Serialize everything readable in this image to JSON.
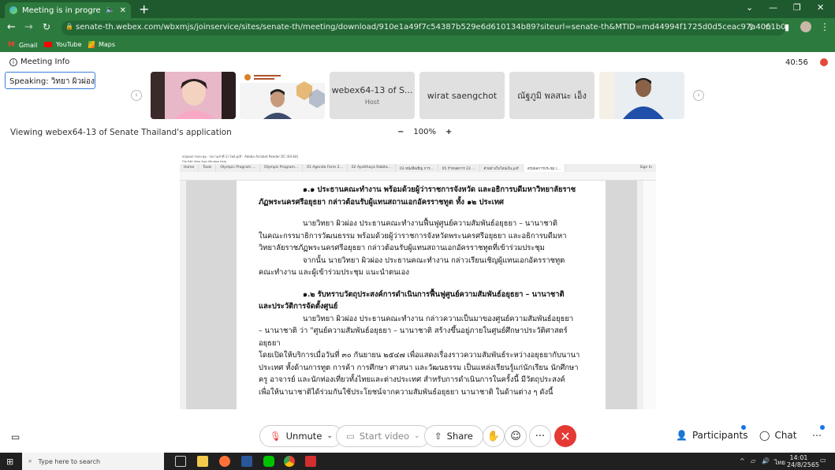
{
  "browser": {
    "tab_title": "Meeting is in progress...",
    "url": "senate-th.webex.com/wbxmjs/joinservice/sites/senate-th/meeting/download/910e1a49f7c54387b529e6d610134b89?siteurl=senate-th&MTID=md44994f1725d0d5ceac97a4061b0d0c6",
    "bookmarks": [
      "Gmail",
      "YouTube",
      "Maps"
    ]
  },
  "meeting": {
    "info_label": "Meeting Info",
    "timer": "40:56",
    "speaking_label": "Speaking: วิทยา ผิวผ่อง",
    "participants": [
      {
        "name": "",
        "sub": "",
        "kind": "video-woman"
      },
      {
        "name": "",
        "sub": "",
        "kind": "video-man-slide"
      },
      {
        "name": "webex64-13 of S...",
        "sub": "Host",
        "kind": "name"
      },
      {
        "name": "wirat saengchot",
        "sub": "",
        "kind": "name"
      },
      {
        "name": "ณัฐภูมิ พลสนะ เอ็ง",
        "sub": "",
        "kind": "name"
      },
      {
        "name": "",
        "sub": "",
        "kind": "video-man"
      }
    ],
    "viewing_text": "Viewing webex64-13 of Senate Thailand's application",
    "zoom_minus": "−",
    "zoom_level": "100%",
    "zoom_plus": "+"
  },
  "shared_doc": {
    "window_title": "สรุปผลการประชุม - (ความจำที่ 1) ไฟล์.pdf - Adobe Acrobat Reader DC (64-bit)",
    "menu": "File  Edit  View  Sign  Window  Help",
    "tabs": [
      "Home",
      "Tools",
      "Olympic Program ...",
      "Olympic Program...",
      "01 Agenda Form 2...",
      "02 Ayutthaya Rabita...",
      "03 หนังสือเชิญ การ...",
      "05 กำหนดการ 23 ...",
      "ตัวอย่างใบโอนเงิน.pdf",
      "สรุปผลการประชุม (..."
    ],
    "signin": "Sign In",
    "lines": [
      {
        "t": "๑.๑ ประธานคณะทำงาน พร้อมด้วยผู้ว่าราชการจังหวัด และอธิการบดีมหาวิทยาลัยราช",
        "c": "h ind"
      },
      {
        "t": "ภัฏพระนครศรีอยุธยา กล่าวต้อนรับผู้แทนสถานเอกอัครราชทูต ทั้ง ๑๒ ประเทศ",
        "c": "h"
      },
      {
        "t": "",
        "c": "gap"
      },
      {
        "t": "นายวิทยา  ผิวผ่อง ประธานคณะทำงานฟื้นฟูศูนย์ความสัมพันธ์อยุธยา – นานาชาติ",
        "c": "ind"
      },
      {
        "t": "ในคณะกรรมาธิการวัฒนธรรม พร้อมด้วยผู้ว่าราชการจังหวัดพระนครศรีอยุธยา และอธิการบดีมหา",
        "c": ""
      },
      {
        "t": "วิทยาลัยราชภัฏพระนครศรีอยุธยา กล่าวต้อนรับผู้แทนสถานเอกอัครราชทูตที่เข้าร่วมประชุม",
        "c": ""
      },
      {
        "t": "จากนั้น นายวิทยา  ผิวผ่อง ประธานคณะทำงาน กล่าวเรียนเชิญผู้แทนเอกอัครราชทูต",
        "c": "ind"
      },
      {
        "t": "คณะทำงาน และผู้เข้าร่วมประชุม แนะนำตนเอง",
        "c": ""
      },
      {
        "t": "",
        "c": "gap"
      },
      {
        "t": "๑.๒ รับทราบวัตถุประสงค์การดำเนินการฟื้นฟูศูนย์ความสัมพันธ์อยุธยา – นานาชาติ",
        "c": "h ind"
      },
      {
        "t": "และประวัติการจัดตั้งศูนย์",
        "c": "h"
      },
      {
        "t": "นายวิทยา  ผิวผ่อง ประธานคณะทำงาน กล่าวความเป็นมาของศูนย์ความสัมพันธ์อยุธยา",
        "c": "ind"
      },
      {
        "t": "– นานาชาติ ว่า \"ศูนย์ความสัมพันธ์อยุธยา – นานาชาติ สร้างขึ้นอยู่ภายในศูนย์ศึกษาประวัติศาสตร์อยุธยา",
        "c": ""
      },
      {
        "t": "โดยเปิดให้บริการเมื่อวันที่ ๓๐ กันยายน ๒๕๔๗ เพื่อแสดงเรื่องราวความสัมพันธ์ระหว่างอยุธยากับนานา",
        "c": ""
      },
      {
        "t": "ประเทศ ทั้งด้านการทูต การค้า การศึกษา ศาสนา และวัฒนธรรม เป็นแหล่งเรียนรู้แก่นักเรียน นักศึกษา",
        "c": ""
      },
      {
        "t": "ครู อาจารย์ และนักท่องเที่ยวทั้งไทยและต่างประเทศ สำหรับการดำเนินการในครั้งนี้ มีวัตถุประสงค์",
        "c": ""
      },
      {
        "t": "เพื่อให้นานาชาติได้ร่วมกันใช้ประโยชน์จากความสัมพันธ์อยุธยา นานาชาติ ในด้านต่าง ๆ ดังนี้",
        "c": ""
      }
    ]
  },
  "controls": {
    "unmute": "Unmute",
    "start_video": "Start video",
    "share": "Share",
    "participants": "Participants",
    "chat": "Chat",
    "more": "···"
  },
  "taskbar": {
    "search_placeholder": "Type here to search",
    "time": "14:01",
    "date": "24/8/2565",
    "lang": "ไทย"
  },
  "colors": {
    "accent": "#2d7a3e",
    "end_call": "#e53935",
    "speaking_border": "#3b7fd8"
  }
}
